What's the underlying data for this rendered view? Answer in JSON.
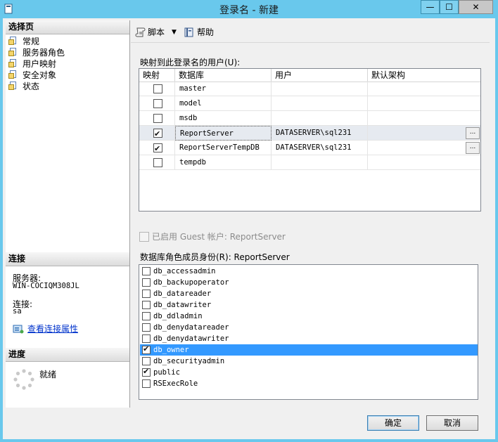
{
  "window": {
    "title": "登录名 - 新建",
    "min_glyph": "—",
    "max_glyph": "☐",
    "close_glyph": "✕"
  },
  "left": {
    "select_page_header": "选择页",
    "pages": [
      {
        "label": "常规"
      },
      {
        "label": "服务器角色"
      },
      {
        "label": "用户映射"
      },
      {
        "label": "安全对象"
      },
      {
        "label": "状态"
      }
    ],
    "connection_header": "连接",
    "server_label": "服务器:",
    "server_value": "WIN-COCIQM308JL",
    "connection_label": "连接:",
    "connection_value": "sa",
    "view_conn_props": "查看连接属性",
    "progress_header": "进度",
    "progress_status": "就绪"
  },
  "toolbar": {
    "script_label": "脚本",
    "help_label": "帮助"
  },
  "mapping": {
    "title": "映射到此登录名的用户(U):",
    "columns": [
      "映射",
      "数据库",
      "用户",
      "默认架构"
    ],
    "rows": [
      {
        "map": false,
        "db": "master",
        "user": "",
        "schema": ""
      },
      {
        "map": false,
        "db": "model",
        "user": "",
        "schema": ""
      },
      {
        "map": false,
        "db": "msdb",
        "user": "",
        "schema": ""
      },
      {
        "map": true,
        "db": "ReportServer",
        "user": "DATASERVER\\sql231",
        "schema": "",
        "ellipsis": "..."
      },
      {
        "map": true,
        "db": "ReportServerTempDB",
        "user": "DATASERVER\\sql231",
        "schema": "",
        "ellipsis": "..."
      },
      {
        "map": false,
        "db": "tempdb",
        "user": "",
        "schema": ""
      }
    ]
  },
  "guest": {
    "label": "已启用 Guest 帐户: ReportServer"
  },
  "roles": {
    "title": "数据库角色成员身份(R): ReportServer",
    "items": [
      {
        "name": "db_accessadmin",
        "checked": false
      },
      {
        "name": "db_backupoperator",
        "checked": false
      },
      {
        "name": "db_datareader",
        "checked": false
      },
      {
        "name": "db_datawriter",
        "checked": false
      },
      {
        "name": "db_ddladmin",
        "checked": false
      },
      {
        "name": "db_denydatareader",
        "checked": false
      },
      {
        "name": "db_denydatawriter",
        "checked": false
      },
      {
        "name": "db_owner",
        "checked": true,
        "selected": true
      },
      {
        "name": "db_securityadmin",
        "checked": false
      },
      {
        "name": "public",
        "checked": true
      },
      {
        "name": "RSExecRole",
        "checked": false
      }
    ]
  },
  "footer": {
    "ok": "确定",
    "cancel": "取消"
  }
}
